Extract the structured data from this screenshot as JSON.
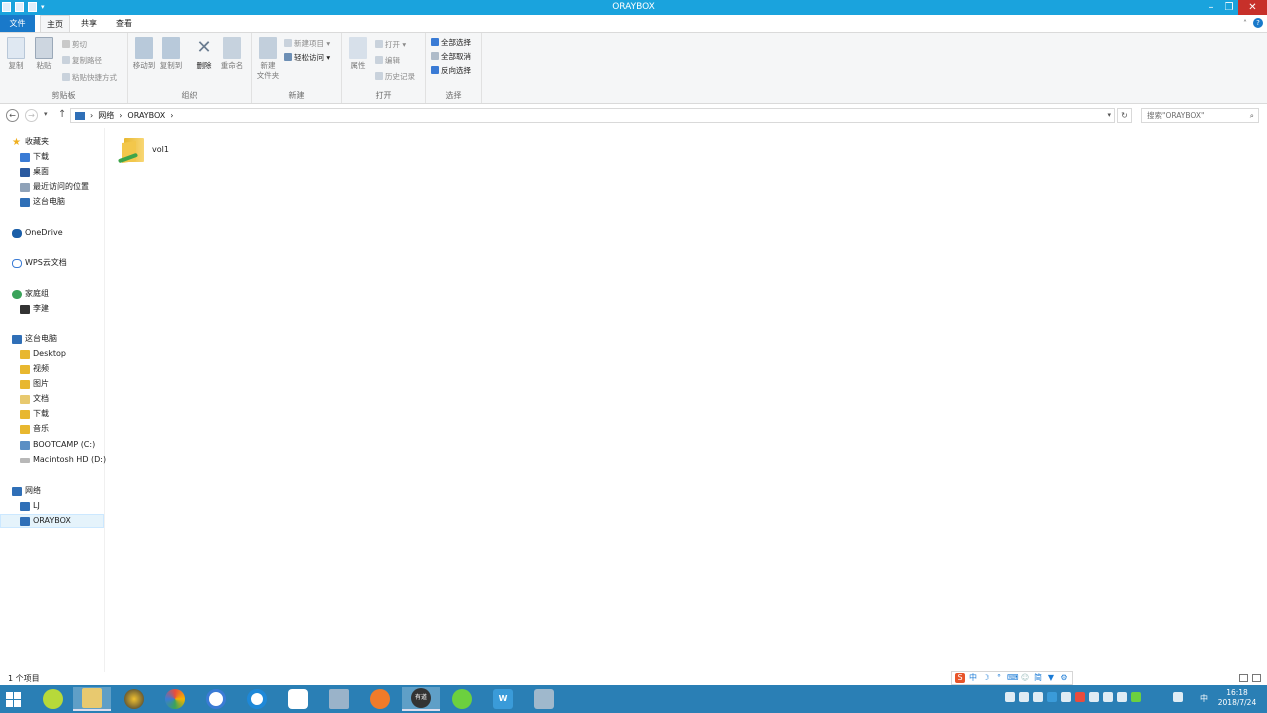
{
  "window": {
    "title": "ORAYBOX",
    "min": "–",
    "max": "❐",
    "close": "✕"
  },
  "tabs": {
    "file": "文件",
    "home": "主页",
    "share": "共享",
    "view": "查看"
  },
  "ribbon": {
    "clipboard": {
      "label": "剪贴板",
      "copy": "复制",
      "paste": "粘贴",
      "cut": "剪切",
      "copy_path": "复制路径",
      "paste_shortcut": "粘贴快捷方式"
    },
    "organize": {
      "label": "组织",
      "move_to": "移动到",
      "copy_to": "复制到",
      "delete": "删除",
      "rename": "重命名"
    },
    "new": {
      "label": "新建",
      "new_folder_1": "新建",
      "new_folder_2": "文件夹",
      "new_item": "新建项目 ▾",
      "easy_access": "轻松访问 ▾"
    },
    "open": {
      "label": "打开",
      "properties": "属性",
      "open": "打开 ▾",
      "edit": "编辑",
      "history": "历史记录"
    },
    "select": {
      "label": "选择",
      "select_all": "全部选择",
      "select_none": "全部取消",
      "invert": "反向选择"
    }
  },
  "address": {
    "crumbs": [
      "网络",
      "ORAYBOX"
    ],
    "sep": "›",
    "search_placeholder": "搜索\"ORAYBOX\""
  },
  "nav": {
    "favorites": "收藏夹",
    "fav_items": [
      "下载",
      "桌面",
      "最近访问的位置",
      "这台电脑"
    ],
    "onedrive": "OneDrive",
    "wps": "WPS云文档",
    "homegroup": "家庭组",
    "homegroup_items": [
      "李建"
    ],
    "thispc": "这台电脑",
    "pc_items": [
      "Desktop",
      "视频",
      "图片",
      "文档",
      "下载",
      "音乐",
      "BOOTCAMP (C:)",
      "Macintosh HD (D:)"
    ],
    "network": "网络",
    "net_items": [
      "LJ",
      "ORAYBOX"
    ]
  },
  "content": {
    "items": [
      {
        "name": "vol1"
      }
    ]
  },
  "status": {
    "count": "1 个项目"
  },
  "ime": {
    "mode": "中",
    "simp": "简"
  },
  "taskbar": {
    "youdao_label": "有道",
    "lang": "中",
    "time": "16:18",
    "date": "2018/7/24"
  },
  "colors": {
    "accent": "#1aa3dd",
    "file_tab": "#1979ca",
    "taskbar": "#2a7fb5",
    "close": "#c7302a"
  }
}
